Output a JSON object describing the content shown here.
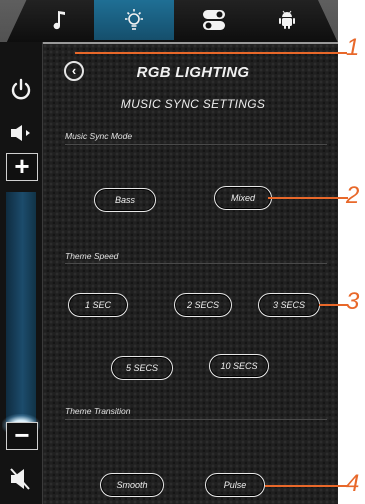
{
  "tabs": [
    {
      "name": "music",
      "icon": "music-note-icon"
    },
    {
      "name": "lighting",
      "icon": "light-bulb-icon",
      "active": true
    },
    {
      "name": "settings",
      "icon": "toggle-switches-icon"
    },
    {
      "name": "android",
      "icon": "android-icon"
    }
  ],
  "sidebar": {
    "icons": [
      "power-icon",
      "speaker-icon",
      "volume-up-icon",
      "volume-down-icon",
      "mute-icon"
    ],
    "plus_label": "+",
    "minus_label": "−"
  },
  "header": {
    "title": "RGB LIGHTING",
    "subtitle": "MUSIC SYNC SETTINGS"
  },
  "music_sync_mode": {
    "label": "Music Sync Mode",
    "options": [
      "Bass",
      "Mixed"
    ]
  },
  "theme_speed": {
    "label": "Theme Speed",
    "options": [
      "1 SEC",
      "2 SECS",
      "3 SECS",
      "5 SECS",
      "10 SECS"
    ]
  },
  "theme_transition": {
    "label": "Theme Transition",
    "options": [
      "Smooth",
      "Pulse"
    ]
  },
  "callouts": [
    "1",
    "2",
    "3",
    "4"
  ],
  "colors": {
    "accent_tab": "#1f6f95",
    "callout": "#e8682a",
    "background": "#202020"
  }
}
